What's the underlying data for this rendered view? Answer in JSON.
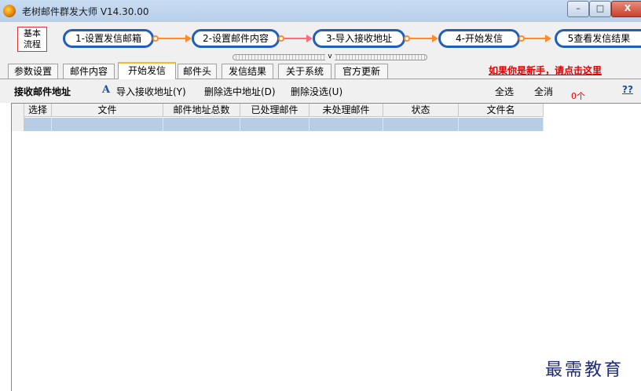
{
  "window": {
    "title": "老树邮件群发大师 V14.30.00",
    "minimize_label": "–",
    "maximize_label": "□",
    "close_label": "X"
  },
  "workflow": {
    "basic_label_line1": "基本",
    "basic_label_line2": "流程",
    "steps": [
      {
        "label": "1-设置发信邮箱"
      },
      {
        "label": "2-设置邮件内容"
      },
      {
        "label": "3-导入接收地址"
      },
      {
        "label": "4-开始发信"
      },
      {
        "label": "5查看发信结果"
      }
    ],
    "collapse_glyph": "v",
    "colors": {
      "step_border": "#1f5fb5",
      "arrow_orange": "#ff8a2a",
      "arrow_pink": "#ff6a7a"
    }
  },
  "tabs": [
    {
      "label": "参数设置"
    },
    {
      "label": "邮件内容"
    },
    {
      "label": "开始发信",
      "active": true
    },
    {
      "label": "邮件头"
    },
    {
      "label": "发信结果"
    },
    {
      "label": "关于系统"
    },
    {
      "label": "官方更新"
    }
  ],
  "newbie_link": "如果你是新手，请点击这里",
  "toolbar": {
    "section_title": "接收邮件地址",
    "icon": "font-a-icon",
    "import_label": "导入接收地址(Y)",
    "delete_selected_label": "删除选中地址(D)",
    "delete_unselected_label": "删除没选(U)",
    "select_all_label": "全选",
    "deselect_all_label": "全消",
    "count_label": "0个",
    "help_label": "??"
  },
  "grid": {
    "columns": [
      "选择",
      "文件",
      "邮件地址总数",
      "已处理邮件",
      "未处理邮件",
      "状态",
      "文件名"
    ],
    "row_selected_color": "#b8cce4"
  },
  "watermark": "最需教育"
}
